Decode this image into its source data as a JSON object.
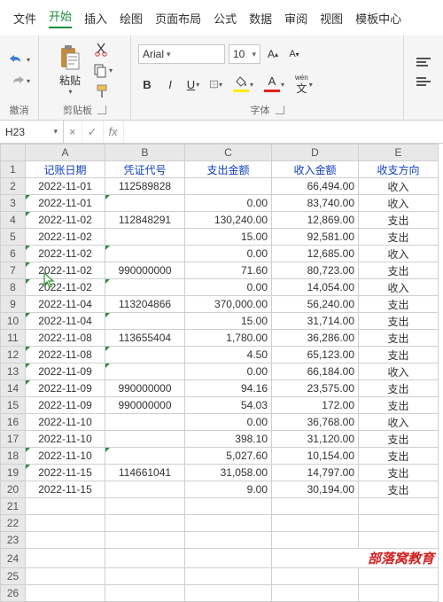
{
  "menubar": [
    "文件",
    "开始",
    "插入",
    "绘图",
    "页面布局",
    "公式",
    "数据",
    "审阅",
    "视图",
    "模板中心"
  ],
  "menubar_active": 1,
  "ribbon": {
    "undo_label": "撤消",
    "clipboard_label": "剪贴板",
    "paste_label": "粘贴",
    "font_label": "字体",
    "font_name": "Arial",
    "font_size": "10",
    "wen_char": "wén",
    "wen_sub": "文"
  },
  "name_box": "H23",
  "fx_label": "fx",
  "columns": [
    "A",
    "B",
    "C",
    "D",
    "E"
  ],
  "headers": [
    "记账日期",
    "凭证代号",
    "支出金额",
    "收入金额",
    "收支方向"
  ],
  "rows": [
    [
      "2022-11-01",
      "112589828",
      "",
      "66,494.00",
      "收入"
    ],
    [
      "2022-11-01",
      "",
      "0.00",
      "83,740.00",
      "收入"
    ],
    [
      "2022-11-02",
      "112848291",
      "130,240.00",
      "12,869.00",
      "支出"
    ],
    [
      "2022-11-02",
      "",
      "15.00",
      "92,581.00",
      "支出"
    ],
    [
      "2022-11-02",
      "",
      "0.00",
      "12,685.00",
      "收入"
    ],
    [
      "2022-11-02",
      "990000000",
      "71.60",
      "80,723.00",
      "支出"
    ],
    [
      "2022-11-02",
      "",
      "0.00",
      "14,054.00",
      "收入"
    ],
    [
      "2022-11-04",
      "113204866",
      "370,000.00",
      "56,240.00",
      "支出"
    ],
    [
      "2022-11-04",
      "",
      "15.00",
      "31,714.00",
      "支出"
    ],
    [
      "2022-11-08",
      "113655404",
      "1,780.00",
      "36,286.00",
      "支出"
    ],
    [
      "2022-11-08",
      "",
      "4.50",
      "65,123.00",
      "支出"
    ],
    [
      "2022-11-09",
      "",
      "0.00",
      "66,184.00",
      "收入"
    ],
    [
      "2022-11-09",
      "990000000",
      "94.16",
      "23,575.00",
      "支出"
    ],
    [
      "2022-11-09",
      "990000000",
      "54.03",
      "172.00",
      "支出"
    ],
    [
      "2022-11-10",
      "",
      "0.00",
      "36,768.00",
      "收入"
    ],
    [
      "2022-11-10",
      "",
      "398.10",
      "31,120.00",
      "支出"
    ],
    [
      "2022-11-10",
      "",
      "5,027.60",
      "10,154.00",
      "支出"
    ],
    [
      "2022-11-15",
      "114661041",
      "31,058.00",
      "14,797.00",
      "支出"
    ],
    [
      "2022-11-15",
      "",
      "9.00",
      "30,194.00",
      "支出"
    ]
  ],
  "green_markers": {
    "1": [
      0
    ],
    "3": [
      0,
      1
    ],
    "4": [
      0
    ],
    "6": [
      0,
      1
    ],
    "7": [
      0
    ],
    "8": [
      0,
      1
    ],
    "10": [
      0,
      1
    ],
    "12": [
      0,
      1
    ],
    "13": [
      0,
      1
    ],
    "14": [
      0
    ],
    "18": [
      0,
      1
    ],
    "19": [
      0
    ]
  },
  "brand": "部落窝教育",
  "empty_rows": [
    21,
    22,
    23,
    24,
    25,
    26
  ]
}
